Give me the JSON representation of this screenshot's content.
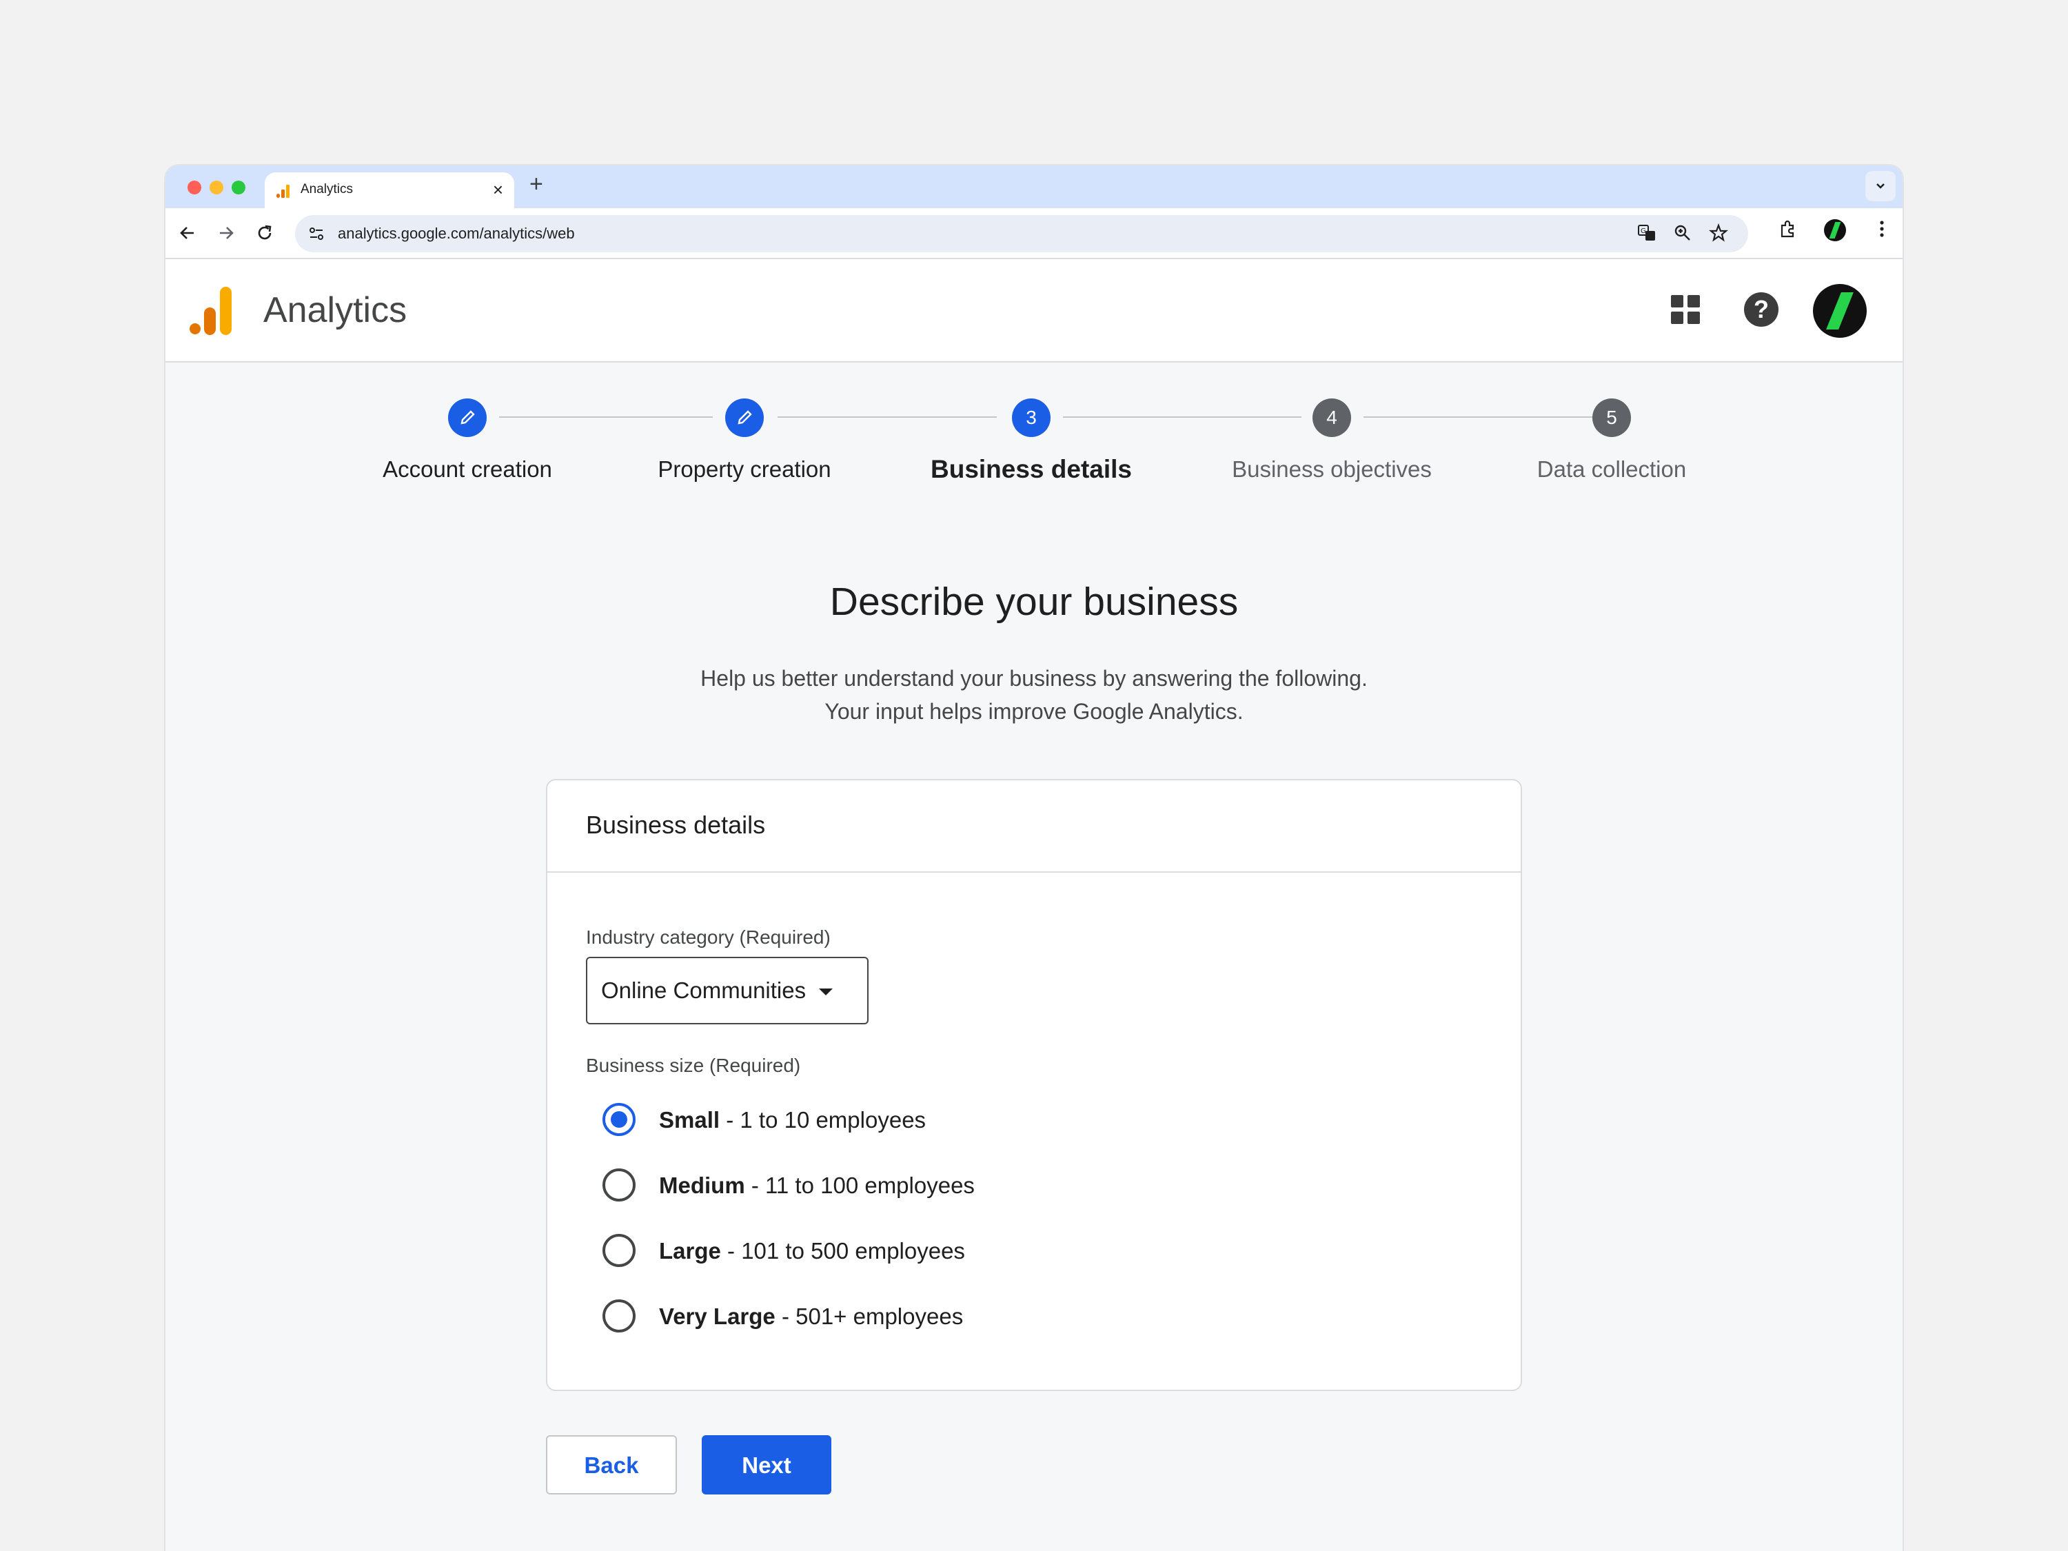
{
  "browser": {
    "tab_title": "Analytics",
    "tab_close": "×",
    "new_tab": "+",
    "url": "analytics.google.com/analytics/web",
    "icons": [
      "back-icon",
      "forward-icon",
      "reload-icon",
      "site-info-icon",
      "translate-icon",
      "zoom-icon",
      "star-icon",
      "extensions-icon",
      "profile-icon",
      "menu-icon"
    ]
  },
  "app": {
    "title": "Analytics",
    "help_glyph": "?"
  },
  "stepper": {
    "steps": [
      {
        "label": "Account creation",
        "state": "done",
        "number": ""
      },
      {
        "label": "Property creation",
        "state": "done",
        "number": ""
      },
      {
        "label": "Business details",
        "state": "active",
        "number": "3"
      },
      {
        "label": "Business objectives",
        "state": "pending",
        "number": "4"
      },
      {
        "label": "Data collection",
        "state": "pending",
        "number": "5"
      }
    ]
  },
  "page": {
    "heading": "Describe your business",
    "subtitle_line1": "Help us better understand your business by answering the following.",
    "subtitle_line2": "Your input helps improve Google Analytics."
  },
  "card": {
    "title": "Business details",
    "industry_label": "Industry category (Required)",
    "industry_value": "Online Communities",
    "size_label": "Business size (Required)",
    "size_options": [
      {
        "bold": "Small",
        "rest": " - 1 to 10 employees",
        "checked": true
      },
      {
        "bold": "Medium",
        "rest": " - 11 to 100 employees",
        "checked": false
      },
      {
        "bold": "Large",
        "rest": " - 101 to 500 employees",
        "checked": false
      },
      {
        "bold": "Very Large",
        "rest": " - 501+ employees",
        "checked": false
      }
    ]
  },
  "actions": {
    "back_label": "Back",
    "next_label": "Next"
  },
  "colors": {
    "accent": "#1b5ee6",
    "pending_step": "#5f6368",
    "tab_strip": "#d3e3fd"
  }
}
